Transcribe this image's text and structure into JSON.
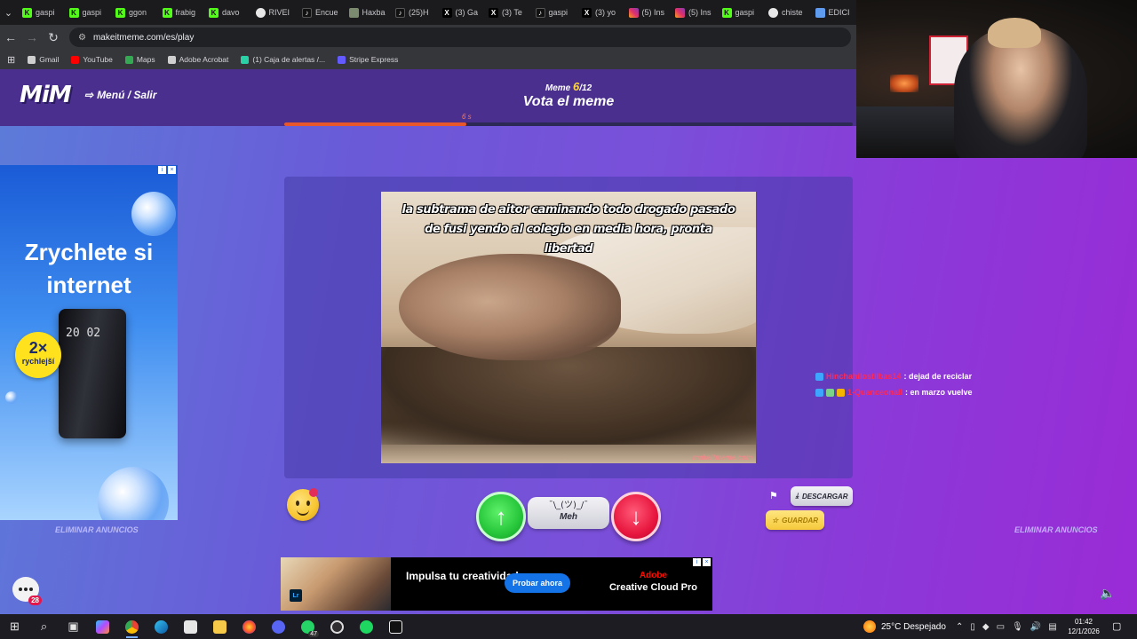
{
  "browser": {
    "tabs": [
      {
        "title": "gaspi",
        "icon": "k"
      },
      {
        "title": "gaspi",
        "icon": "k"
      },
      {
        "title": "ggon",
        "icon": "k"
      },
      {
        "title": "frabig",
        "icon": "k"
      },
      {
        "title": "davo",
        "icon": "k"
      },
      {
        "title": "RIVEI",
        "icon": "g"
      },
      {
        "title": "Encue",
        "icon": "t"
      },
      {
        "title": "Haxba",
        "icon": "h"
      },
      {
        "title": "(25)H",
        "icon": "t"
      },
      {
        "title": "(3) Ga",
        "icon": "x"
      },
      {
        "title": "(3) Te",
        "icon": "x"
      },
      {
        "title": "gaspi",
        "icon": "t"
      },
      {
        "title": "(3) yo",
        "icon": "x"
      },
      {
        "title": "(5) Ins",
        "icon": "ig"
      },
      {
        "title": "(5) Ins",
        "icon": "ig"
      },
      {
        "title": "gaspi",
        "icon": "k"
      },
      {
        "title": "chiste",
        "icon": "g"
      },
      {
        "title": "EDICI",
        "icon": "d"
      }
    ],
    "url": "makeitmeme.com/es/play",
    "bookmarks": [
      {
        "label": "Gmail",
        "color": "#cfcfcf"
      },
      {
        "label": "YouTube",
        "color": "#ff0000"
      },
      {
        "label": "Maps",
        "color": "#34a853"
      },
      {
        "label": "Adobe Acrobat",
        "color": "#cfcfcf"
      },
      {
        "label": "(1) Caja de alertas /...",
        "color": "#2ad1a6"
      },
      {
        "label": "Stripe Express",
        "color": "#635bff"
      }
    ]
  },
  "game": {
    "logo": "MiM",
    "menu_label": "Menú / Salir",
    "meme_prefix": "Meme",
    "meme_current": "6",
    "meme_total": "/12",
    "title": "Vota el meme",
    "timer_label": "6 s",
    "timer_progress": 0.32,
    "meme_caption": "la subtrama de aitor caminando todo drogado pasado de fusi yendo al colegio en media hora, pronta libertad",
    "meme_watermark": "makeitmeme.com",
    "meh_shrug": "¯\\_(ツ)_/¯",
    "meh_label": "Meh",
    "download_label": "DESCARGAR",
    "save_label": "GUARDAR",
    "remove_ads_left": "ELIMINAR ANUNCIOS",
    "remove_ads_right": "ELIMINAR ANUNCIOS"
  },
  "left_ad": {
    "headline": "Zrychlete si internet",
    "badge_big": "2×",
    "badge_small": "rychlejší",
    "device_text": "20 02"
  },
  "bottom_ad": {
    "headline": "Impulsa tu creatividad",
    "cta": "Probar ahora",
    "brand": "Adobe",
    "product": "Creative Cloud Pro",
    "app_badge": "Lr"
  },
  "chat": [
    {
      "user": "Hinchahilostilbas14",
      "message": ": dejad de reciclar"
    },
    {
      "user": "1-Quanceonall",
      "message": ": en marzo vuelve"
    }
  ],
  "chat_fab_count": "28",
  "taskbar": {
    "weather": "25°C  Despejado",
    "time": "01:42",
    "date": "12/1/2026",
    "whatsapp_badge": "47"
  },
  "colors": {
    "accent_orange": "#e8562c",
    "vote_up": "#26c63a",
    "vote_down": "#e8173f",
    "meme_index": "#ffd43b"
  }
}
